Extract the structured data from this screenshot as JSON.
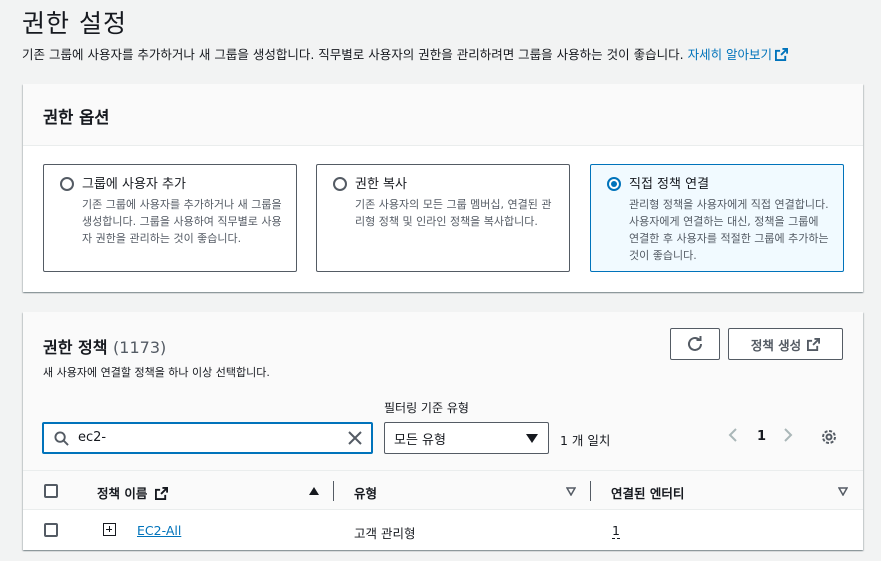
{
  "page": {
    "title": "권한 설정",
    "description": "기존 그룹에 사용자를 추가하거나 새 그룹을 생성합니다. 직무별로 사용자의 권한을 관리하려면 그룹을 사용하는 것이 좋습니다.",
    "learn_more": "자세히 알아보기"
  },
  "options": {
    "heading": "권한 옵션",
    "tiles": [
      {
        "title": "그룹에 사용자 추가",
        "desc": "기존 그룹에 사용자를 추가하거나 새 그룹을 생성합니다. 그룹을 사용하여 직무별로 사용자 권한을 관리하는 것이 좋습니다.",
        "selected": false
      },
      {
        "title": "권한 복사",
        "desc": "기존 사용자의 모든 그룹 멤버십, 연결된 관리형 정책 및 인라인 정책을 복사합니다.",
        "selected": false
      },
      {
        "title": "직접 정책 연결",
        "desc": "관리형 정책을 사용자에게 직접 연결합니다. 사용자에게 연결하는 대신, 정책을 그룹에 연결한 후 사용자를 적절한 그룹에 추가하는 것이 좋습니다.",
        "selected": true
      }
    ]
  },
  "policies": {
    "heading": "권한 정책",
    "count": "(1173)",
    "description": "새 사용자에 연결할 정책을 하나 이상 선택합니다.",
    "create_label": "정책 생성",
    "search_value": "ec2-",
    "filter_label": "필터링 기준 유형",
    "filter_value": "모든 유형",
    "match_text": "1 개 일치",
    "page": "1",
    "columns": {
      "name": "정책 이름",
      "type": "유형",
      "entities": "연결된 엔터티"
    },
    "rows": [
      {
        "name": "EC2-All",
        "type": "고객 관리형",
        "entities": "1"
      }
    ]
  },
  "colors": {
    "accent": "#0073bb",
    "border": "#545b64"
  }
}
